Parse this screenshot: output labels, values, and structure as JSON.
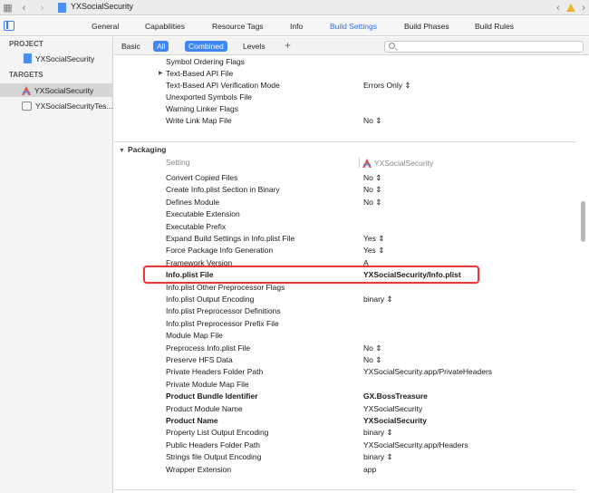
{
  "jumpbar": {
    "title": "YXSocialSecurity"
  },
  "tabs": [
    {
      "label": "General",
      "active": false
    },
    {
      "label": "Capabilities",
      "active": false
    },
    {
      "label": "Resource Tags",
      "active": false
    },
    {
      "label": "Info",
      "active": false
    },
    {
      "label": "Build Settings",
      "active": true
    },
    {
      "label": "Build Phases",
      "active": false
    },
    {
      "label": "Build Rules",
      "active": false
    }
  ],
  "navigator": {
    "project_header": "PROJECT",
    "project_item": "YXSocialSecurity",
    "targets_header": "TARGETS",
    "target_items": [
      "YXSocialSecurity",
      "YXSocialSecurityTes..."
    ]
  },
  "filterbar": {
    "basic": "Basic",
    "all": "All",
    "combined": "Combined",
    "levels": "Levels",
    "add": "+",
    "search_placeholder": ""
  },
  "top_rows": [
    {
      "label": "Symbol Ordering Flags",
      "value": ""
    },
    {
      "label": "Text-Based API File",
      "value": "",
      "disclosure": true
    },
    {
      "label": "Text-Based API Verification Mode",
      "value": "Errors Only ⇕"
    },
    {
      "label": "Unexported Symbols File",
      "value": ""
    },
    {
      "label": "Warning Linker Flags",
      "value": ""
    },
    {
      "label": "Write Link Map File",
      "value": "No ⇕"
    }
  ],
  "packaging": {
    "section_title": "Packaging",
    "column_setting": "Setting",
    "column_target": "YXSocialSecurity",
    "rows": [
      {
        "label": "Convert Copied Files",
        "value": "No ⇕",
        "bold": false
      },
      {
        "label": "Create Info.plist Section in Binary",
        "value": "No ⇕",
        "bold": false
      },
      {
        "label": "Defines Module",
        "value": "No ⇕",
        "bold": false
      },
      {
        "label": "Executable Extension",
        "value": "",
        "bold": false
      },
      {
        "label": "Executable Prefix",
        "value": "",
        "bold": false
      },
      {
        "label": "Expand Build Settings in Info.plist File",
        "value": "Yes ⇕",
        "bold": false
      },
      {
        "label": "Force Package Info Generation",
        "value": "Yes ⇕",
        "bold": false
      },
      {
        "label": "Framework Version",
        "value": "A",
        "bold": false
      },
      {
        "label": "Info.plist File",
        "value": "YXSocialSecurity/Info.plist",
        "bold": true
      },
      {
        "label": "Info.plist Other Preprocessor Flags",
        "value": "",
        "bold": false
      },
      {
        "label": "Info.plist Output Encoding",
        "value": "binary ⇕",
        "bold": false
      },
      {
        "label": "Info.plist Preprocessor Definitions",
        "value": "",
        "bold": false
      },
      {
        "label": "Info.plist Preprocessor Prefix File",
        "value": "",
        "bold": false
      },
      {
        "label": "Module Map File",
        "value": "",
        "bold": false
      },
      {
        "label": "Preprocess Info.plist File",
        "value": "No ⇕",
        "bold": false
      },
      {
        "label": "Preserve HFS Data",
        "value": "No ⇕",
        "bold": false
      },
      {
        "label": "Private Headers Folder Path",
        "value": "YXSocialSecurity.app/PrivateHeaders",
        "bold": false
      },
      {
        "label": "Private Module Map File",
        "value": "",
        "bold": false
      },
      {
        "label": "Product Bundle Identifier",
        "value": "GX.BossTreasure",
        "bold": true
      },
      {
        "label": "Product Module Name",
        "value": "YXSocialSecurity",
        "bold": false
      },
      {
        "label": "Product Name",
        "value": "YXSocialSecurity",
        "bold": true
      },
      {
        "label": "Property List Output Encoding",
        "value": "binary ⇕",
        "bold": false
      },
      {
        "label": "Public Headers Folder Path",
        "value": "YXSocialSecurity.app/Headers",
        "bold": false
      },
      {
        "label": "Strings file Output Encoding",
        "value": "binary ⇕",
        "bold": false
      },
      {
        "label": "Wrapper Extension",
        "value": "app",
        "bold": false
      }
    ]
  },
  "colors": {
    "accent": "#3d86f3",
    "highlight": "#e23b3b",
    "warning": "#e8b52c"
  }
}
